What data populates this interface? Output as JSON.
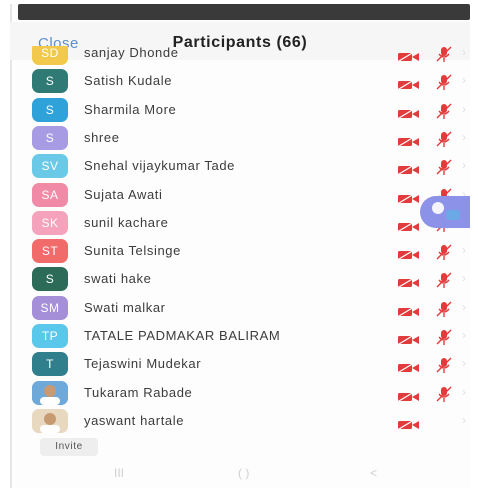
{
  "header": {
    "close_label": "Close",
    "title": "Participants (66)"
  },
  "participants": [
    {
      "name": "sanjay Dhonde",
      "initials": "SD",
      "color": "#f2c94c",
      "video_off": true,
      "muted": true
    },
    {
      "name": "Satish Kudale",
      "initials": "S",
      "color": "#2f7a74",
      "video_off": true,
      "muted": true
    },
    {
      "name": "Sharmila More",
      "initials": "S",
      "color": "#2fa2d9",
      "video_off": true,
      "muted": true
    },
    {
      "name": "shree",
      "initials": "S",
      "color": "#a79be3",
      "video_off": true,
      "muted": true
    },
    {
      "name": "Snehal vijaykumar Tade",
      "initials": "SV",
      "color": "#69c9e6",
      "video_off": true,
      "muted": true
    },
    {
      "name": "Sujata Awati",
      "initials": "SA",
      "color": "#f08aa7",
      "video_off": true,
      "muted": true
    },
    {
      "name": "sunil kacharе",
      "initials": "SK",
      "color": "#f5a3bc",
      "video_off": true,
      "muted": true
    },
    {
      "name": "Sunita Telsinge",
      "initials": "ST",
      "color": "#f26b6b",
      "video_off": true,
      "muted": true
    },
    {
      "name": "swati hake",
      "initials": "S",
      "color": "#2c6b58",
      "video_off": true,
      "muted": true
    },
    {
      "name": "Swati malkar",
      "initials": "SM",
      "color": "#a58fd9",
      "video_off": true,
      "muted": true
    },
    {
      "name": "TATALE PADMAKAR BALIRAM",
      "initials": "TP",
      "color": "#5ac8ea",
      "video_off": true,
      "muted": true
    },
    {
      "name": "Tejaswini Mudekar",
      "initials": "T",
      "color": "#2f7f8c",
      "video_off": true,
      "muted": true
    },
    {
      "name": "Tukaram Rabade",
      "initials": "",
      "color": "#6fa9d9",
      "photo": true,
      "video_off": true,
      "muted": true
    },
    {
      "name": "yaswant hartale",
      "initials": "",
      "color": "#e9d8c0",
      "photo": true,
      "video_off": true,
      "muted": false
    }
  ],
  "invite_label": "Invite",
  "nav": {
    "recents": "III",
    "home": "( )",
    "back": "<"
  },
  "colors": {
    "accent": "#5b8fcf",
    "muted_red": "#e23b3b",
    "bubble": "#8c92e8"
  }
}
